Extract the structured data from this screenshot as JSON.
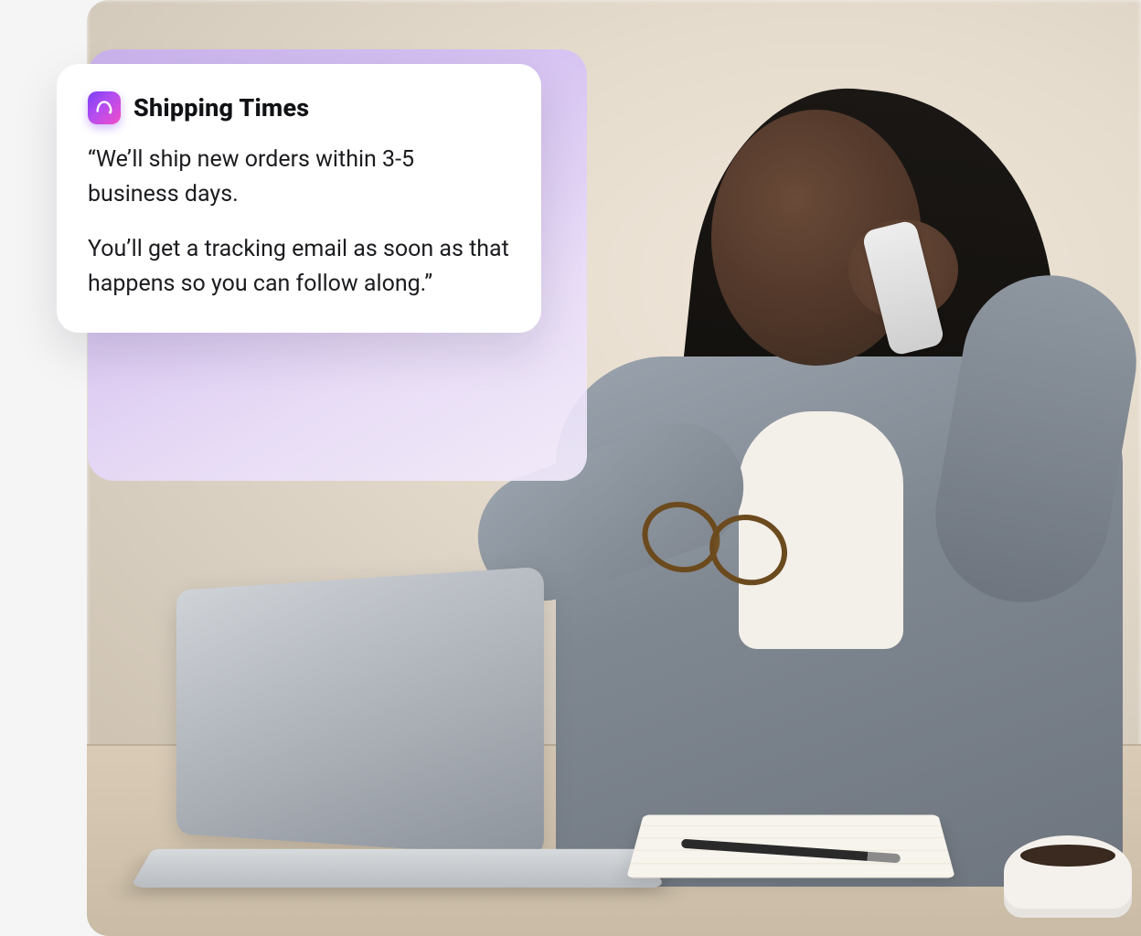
{
  "card": {
    "icon": "ai-logo-icon",
    "title": "Shipping Times",
    "paragraph1": "“We’ll ship new orders within 3-5 business days.",
    "paragraph2": "You’ll get a tracking email as soon as that happens so you can follow along.”"
  },
  "colors": {
    "gradient_start": "#7b3cf5",
    "gradient_mid": "#b44df0",
    "gradient_end": "#f24bc8",
    "card_bg": "#ffffff",
    "text": "#111215"
  }
}
